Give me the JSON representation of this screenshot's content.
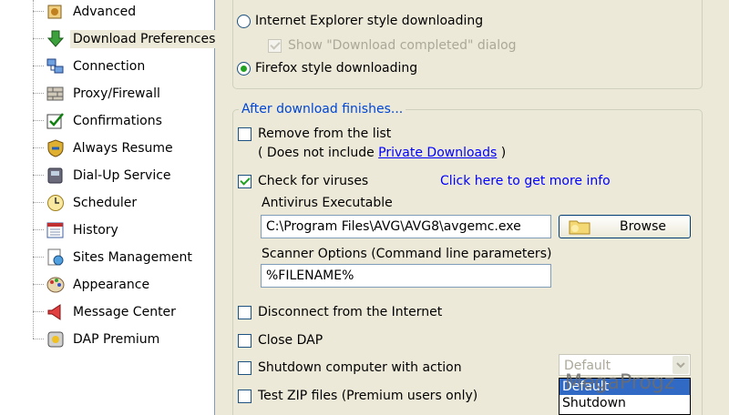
{
  "sidebar": {
    "items": [
      {
        "label": "Advanced",
        "icon": "advanced-icon",
        "selected": false
      },
      {
        "label": "Download Preferences",
        "icon": "download-arrow-icon",
        "selected": true
      },
      {
        "label": "Connection",
        "icon": "connection-icon",
        "selected": false
      },
      {
        "label": "Proxy/Firewall",
        "icon": "firewall-icon",
        "selected": false
      },
      {
        "label": "Confirmations",
        "icon": "checkmark-icon",
        "selected": false
      },
      {
        "label": "Always Resume",
        "icon": "shield-icon",
        "selected": false
      },
      {
        "label": "Dial-Up Service",
        "icon": "phone-icon",
        "selected": false
      },
      {
        "label": "Scheduler",
        "icon": "clock-icon",
        "selected": false
      },
      {
        "label": "History",
        "icon": "history-icon",
        "selected": false
      },
      {
        "label": "Sites Management",
        "icon": "sites-icon",
        "selected": false
      },
      {
        "label": "Appearance",
        "icon": "palette-icon",
        "selected": false
      },
      {
        "label": "Message Center",
        "icon": "megaphone-icon",
        "selected": false
      },
      {
        "label": "DAP Premium",
        "icon": "premium-icon",
        "selected": false
      }
    ]
  },
  "download_style": {
    "ie_style": {
      "label": "Internet Explorer style downloading",
      "selected": false
    },
    "show_completed": {
      "label": "Show \"Download completed\" dialog",
      "checked": true,
      "enabled": false
    },
    "firefox_style": {
      "label": "Firefox style downloading",
      "selected": true
    }
  },
  "after_download": {
    "title": "After download finishes...",
    "remove_from_list": {
      "label": "Remove from the list",
      "checked": false
    },
    "private_note": {
      "prefix": "( Does not include ",
      "link": "Private Downloads",
      "suffix": " )"
    },
    "check_viruses": {
      "label": "Check for viruses",
      "checked": true
    },
    "more_info_link": "Click here to get more info",
    "antivirus_label": "Antivirus Executable",
    "antivirus_value": "C:\\Program Files\\AVG\\AVG8\\avgemc.exe",
    "browse_label": "Browse",
    "scanner_label": "Scanner Options (Command line parameters)",
    "scanner_value": "%FILENAME%",
    "disconnect": {
      "label": "Disconnect from the Internet",
      "checked": false
    },
    "close_dap": {
      "label": "Close DAP",
      "checked": false
    },
    "shutdown": {
      "label": "Shutdown computer with action",
      "checked": false
    },
    "shutdown_action": "Default",
    "shutdown_options": [
      "Default",
      "Shutdown"
    ],
    "test_zip": {
      "label": "Test ZIP files (Premium users only)",
      "checked": false
    }
  },
  "watermark": "MegaProgz",
  "colors": {
    "group_title": "#0046d5",
    "selection_highlight": "#316ac5",
    "check_green": "#21a121"
  }
}
